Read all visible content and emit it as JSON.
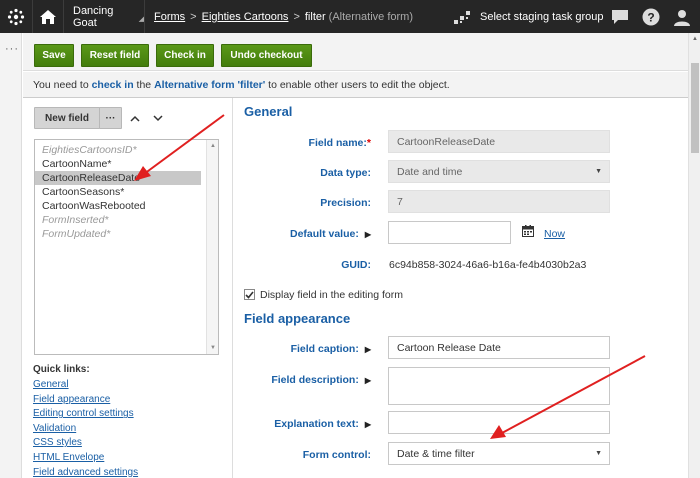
{
  "topbar": {
    "site_name": "Dancing Goat",
    "breadcrumb": [
      "Forms",
      "Eighties Cartoons"
    ],
    "current": "filter",
    "current_sub": "(Alternative form)",
    "staging_label": "Select staging task group"
  },
  "toolbar": {
    "save_label": "Save",
    "reset_label": "Reset field",
    "checkin_label": "Check in",
    "undo_label": "Undo checkout"
  },
  "info": {
    "prefix": "You need to ",
    "link": "check in",
    "middle": " the ",
    "object": "Alternative form 'filter'",
    "suffix": " to enable other users to edit the object."
  },
  "left_panel": {
    "new_field_label": "New field",
    "more_label": "···",
    "fields": [
      {
        "name": "EightiesCartoonsID*",
        "system": true,
        "selected": false
      },
      {
        "name": "CartoonName*",
        "system": false,
        "selected": false
      },
      {
        "name": "CartoonReleaseDate*",
        "system": false,
        "selected": true
      },
      {
        "name": "CartoonSeasons*",
        "system": false,
        "selected": false
      },
      {
        "name": "CartoonWasRebooted",
        "system": false,
        "selected": false
      },
      {
        "name": "FormInserted*",
        "system": true,
        "selected": false
      },
      {
        "name": "FormUpdated*",
        "system": true,
        "selected": false
      }
    ],
    "quick_links_title": "Quick links:",
    "quick_links": [
      "General",
      "Field appearance",
      "Editing control settings",
      "Validation",
      "CSS styles",
      "HTML Envelope",
      "Field advanced settings"
    ]
  },
  "form": {
    "general_title": "General",
    "field_name_label": "Field name:",
    "field_name_value": "CartoonReleaseDate",
    "data_type_label": "Data type:",
    "data_type_value": "Date and time",
    "precision_label": "Precision:",
    "precision_value": "7",
    "default_value_label": "Default value:",
    "default_value_value": "",
    "now_label": "Now",
    "guid_label": "GUID:",
    "guid_value": "6c94b858-3024-46a6-b16a-fe4b4030b2a3",
    "display_label": "Display field in the editing form",
    "display_checked": true,
    "appearance_title": "Field appearance",
    "caption_label": "Field caption:",
    "caption_value": "Cartoon Release Date",
    "description_label": "Field description:",
    "description_value": "",
    "explanation_label": "Explanation text:",
    "explanation_value": "",
    "form_control_label": "Form control:",
    "form_control_value": "Date & time filter"
  },
  "colors": {
    "accent_blue": "#1a5fa5",
    "button_green": "#4f8a10",
    "topbar_bg": "#262626",
    "annotation_red": "#e02020"
  },
  "icons": [
    "kentico-logo-icon",
    "home-icon",
    "staging-icon",
    "chat-icon",
    "help-icon",
    "user-icon",
    "calendar-icon",
    "checkmark-icon",
    "arrow-up-icon",
    "arrow-down-icon"
  ]
}
